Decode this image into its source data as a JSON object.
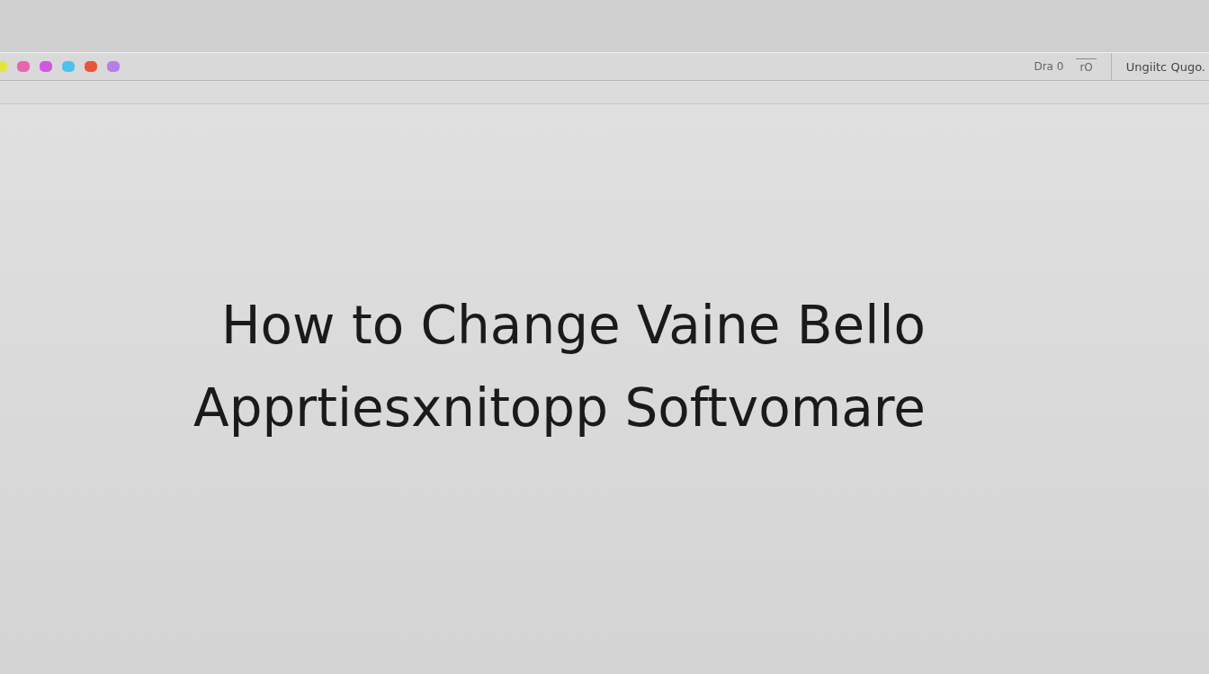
{
  "toolbar": {
    "dots": [
      {
        "color": "#e2e63a"
      },
      {
        "color": "#e866b0"
      },
      {
        "color": "#d058e0"
      },
      {
        "color": "#4cc2ee"
      },
      {
        "color": "#e8553a"
      },
      {
        "color": "#b67ee8"
      }
    ],
    "buttons": [
      "Dra 0",
      "rO"
    ],
    "label": "Ungiitc Qugo."
  },
  "heading": {
    "lines": [
      "How to Change Vaine Bello",
      "Apprtiesxnitopp Softvomare"
    ]
  }
}
